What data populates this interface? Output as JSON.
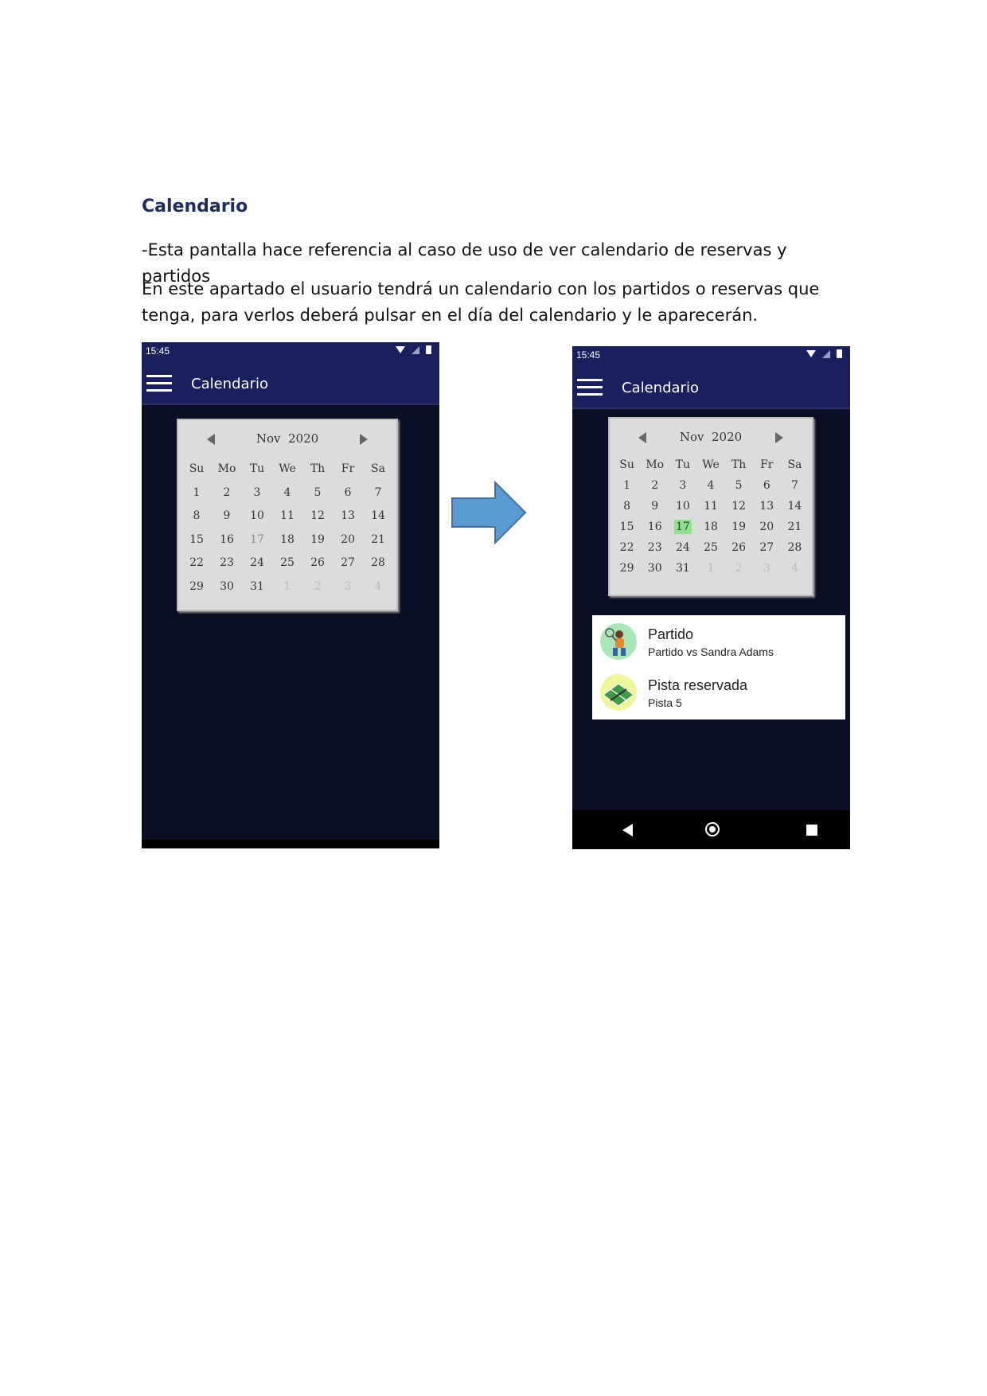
{
  "document": {
    "heading": "Calendario",
    "paragraph_1": "-Esta pantalla hace referencia al caso de uso de ver calendario de reservas y partidos",
    "paragraph_2": "En este apartado el usuario tendrá un calendario con los partidos o reservas que tenga, para verlos deberá pulsar en el día del calendario y le aparecerán."
  },
  "phone": {
    "time": "15:45",
    "app_title": "Calendario"
  },
  "calendar": {
    "month_label": "Nov",
    "year_label": "2020",
    "weekdays": [
      "Su",
      "Mo",
      "Tu",
      "We",
      "Th",
      "Fr",
      "Sa"
    ],
    "days": [
      "1",
      "2",
      "3",
      "4",
      "5",
      "6",
      "7",
      "8",
      "9",
      "10",
      "11",
      "12",
      "13",
      "14",
      "15",
      "16",
      "17",
      "18",
      "19",
      "20",
      "21",
      "22",
      "23",
      "24",
      "25",
      "26",
      "27",
      "28",
      "29",
      "30",
      "31"
    ],
    "trailing_days": [
      "1",
      "2",
      "3",
      "4"
    ],
    "today": "17",
    "selected_day": "17",
    "selected_color": "#8fe08f"
  },
  "results": [
    {
      "title": "Partido",
      "subtitle": "Partido vs Sandra Adams",
      "icon": "tennis-player-icon"
    },
    {
      "title": "Pista reservada",
      "subtitle": "Pista 5",
      "icon": "tennis-court-icon"
    }
  ],
  "colors": {
    "app_bar": "#1a1f5e",
    "screen_background": "#0b0f26",
    "arrow": "#5b9bd5",
    "heading": "#1f2d5c"
  }
}
